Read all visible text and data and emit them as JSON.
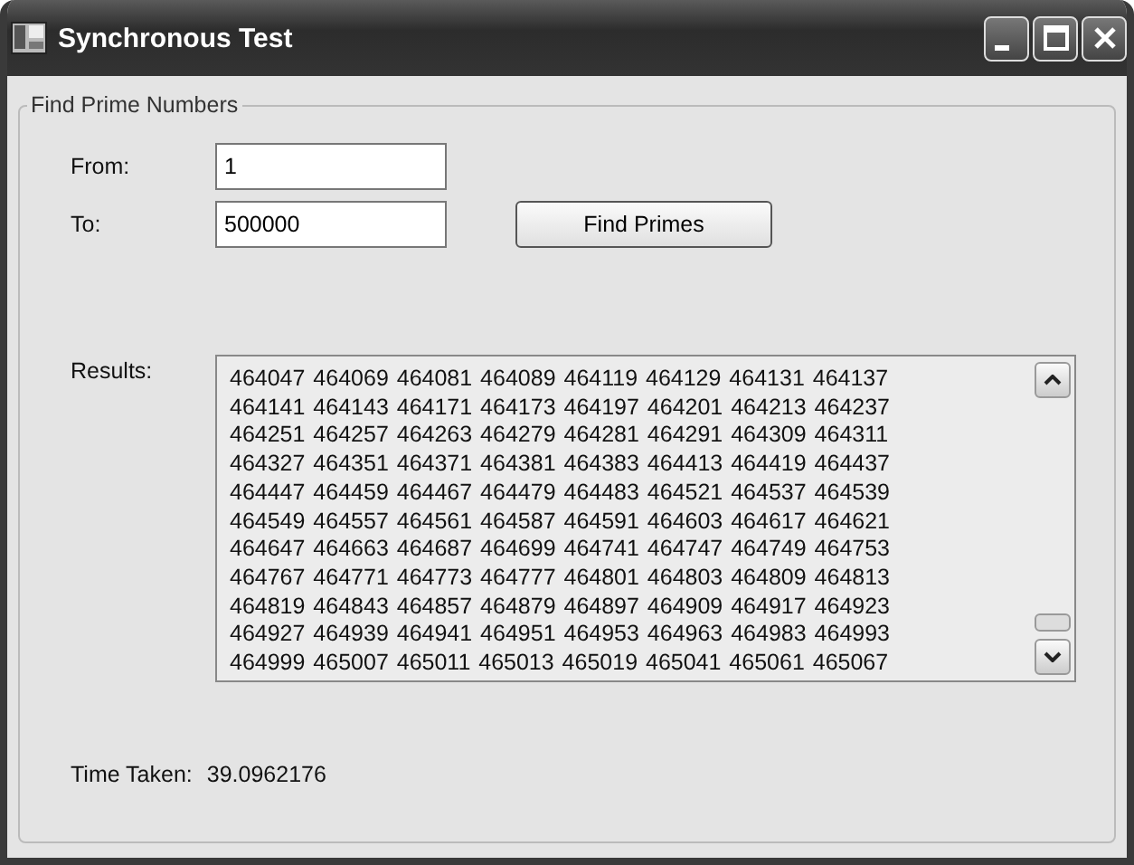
{
  "window": {
    "title": "Synchronous Test"
  },
  "group": {
    "title": "Find Prime Numbers"
  },
  "from": {
    "label": "From:",
    "value": "1"
  },
  "to": {
    "label": "To:",
    "value": "500000"
  },
  "button": {
    "label": "Find Primes"
  },
  "results": {
    "label": "Results:",
    "lines": [
      "464047 464069 464081 464089 464119 464129 464131 464137",
      "464141 464143 464171 464173 464197 464201 464213 464237",
      "464251 464257 464263 464279 464281 464291 464309 464311",
      "464327 464351 464371 464381 464383 464413 464419 464437",
      "464447 464459 464467 464479 464483 464521 464537 464539",
      "464549 464557 464561 464587 464591 464603 464617 464621",
      "464647 464663 464687 464699 464741 464747 464749 464753",
      "464767 464771 464773 464777 464801 464803 464809 464813",
      "464819 464843 464857 464879 464897 464909 464917 464923",
      "464927 464939 464941 464951 464953 464963 464983 464993",
      "464999 465007 465011 465013 465019 465041 465061 465067"
    ]
  },
  "time": {
    "label": "Time Taken:",
    "value": "39.0962176"
  }
}
